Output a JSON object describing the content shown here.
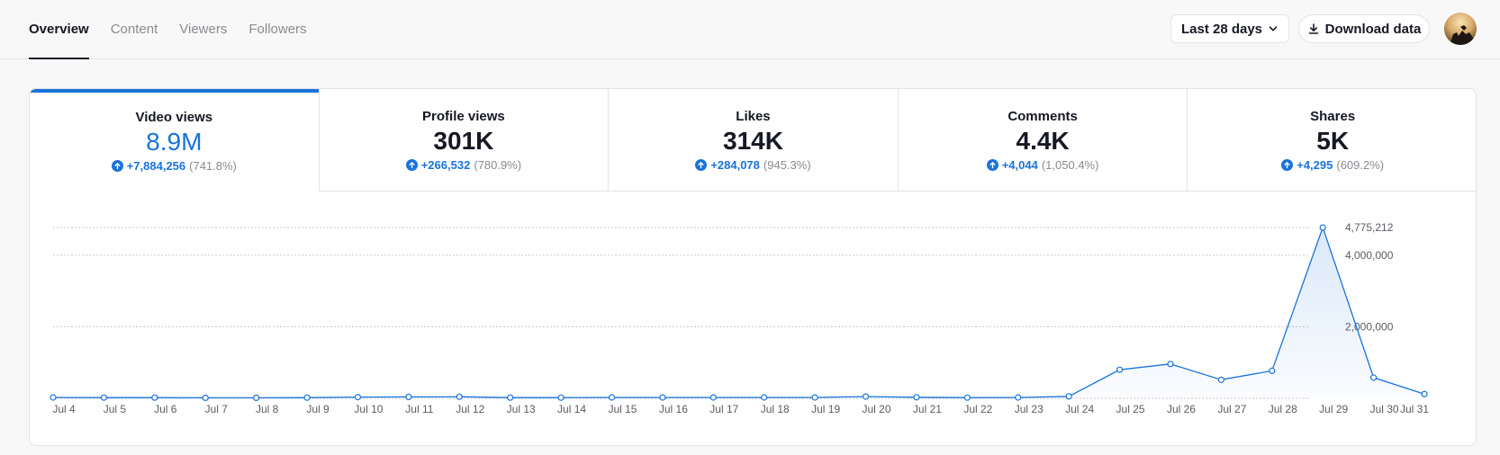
{
  "tabs": [
    {
      "label": "Overview",
      "active": true
    },
    {
      "label": "Content",
      "active": false
    },
    {
      "label": "Viewers",
      "active": false
    },
    {
      "label": "Followers",
      "active": false
    }
  ],
  "header": {
    "range_label": "Last 28 days",
    "download_label": "Download data"
  },
  "metrics": [
    {
      "label": "Video views",
      "value": "8.9M",
      "delta": "+7,884,256",
      "pct": "(741.8%)",
      "active": true
    },
    {
      "label": "Profile views",
      "value": "301K",
      "delta": "+266,532",
      "pct": "(780.9%)",
      "active": false
    },
    {
      "label": "Likes",
      "value": "314K",
      "delta": "+284,078",
      "pct": "(945.3%)",
      "active": false
    },
    {
      "label": "Comments",
      "value": "4.4K",
      "delta": "+4,044",
      "pct": "(1,050.4%)",
      "active": false
    },
    {
      "label": "Shares",
      "value": "5K",
      "delta": "+4,295",
      "pct": "(609.2%)",
      "active": false
    }
  ],
  "colors": {
    "accent": "#1a73d9",
    "text": "#161823",
    "muted": "#8a8b91"
  },
  "chart_data": {
    "type": "area",
    "series": [
      {
        "x": [
          "Jul 4",
          "Jul 5",
          "Jul 6",
          "Jul 7",
          "Jul 8",
          "Jul 9",
          "Jul 10",
          "Jul 11",
          "Jul 12",
          "Jul 13",
          "Jul 14",
          "Jul 15",
          "Jul 16",
          "Jul 17",
          "Jul 18",
          "Jul 19",
          "Jul 20",
          "Jul 21",
          "Jul 22",
          "Jul 23",
          "Jul 24",
          "Jul 25",
          "Jul 26",
          "Jul 27",
          "Jul 28",
          "Jul 29",
          "Jul 30",
          "Jul 31"
        ],
        "values": [
          25000,
          20000,
          20000,
          15000,
          15000,
          20000,
          35000,
          40000,
          45000,
          20000,
          20000,
          25000,
          25000,
          25000,
          25000,
          25000,
          50000,
          30000,
          20000,
          25000,
          55000,
          800000,
          960000,
          520000,
          770000,
          4775212,
          580000,
          120000
        ]
      }
    ],
    "y_ticks": [
      2000000,
      4000000
    ],
    "y_tick_labels": [
      "2,000,000",
      "4,000,000"
    ],
    "max_label": "4,775,212",
    "ylim": [
      0,
      4775212
    ],
    "grid": true
  }
}
